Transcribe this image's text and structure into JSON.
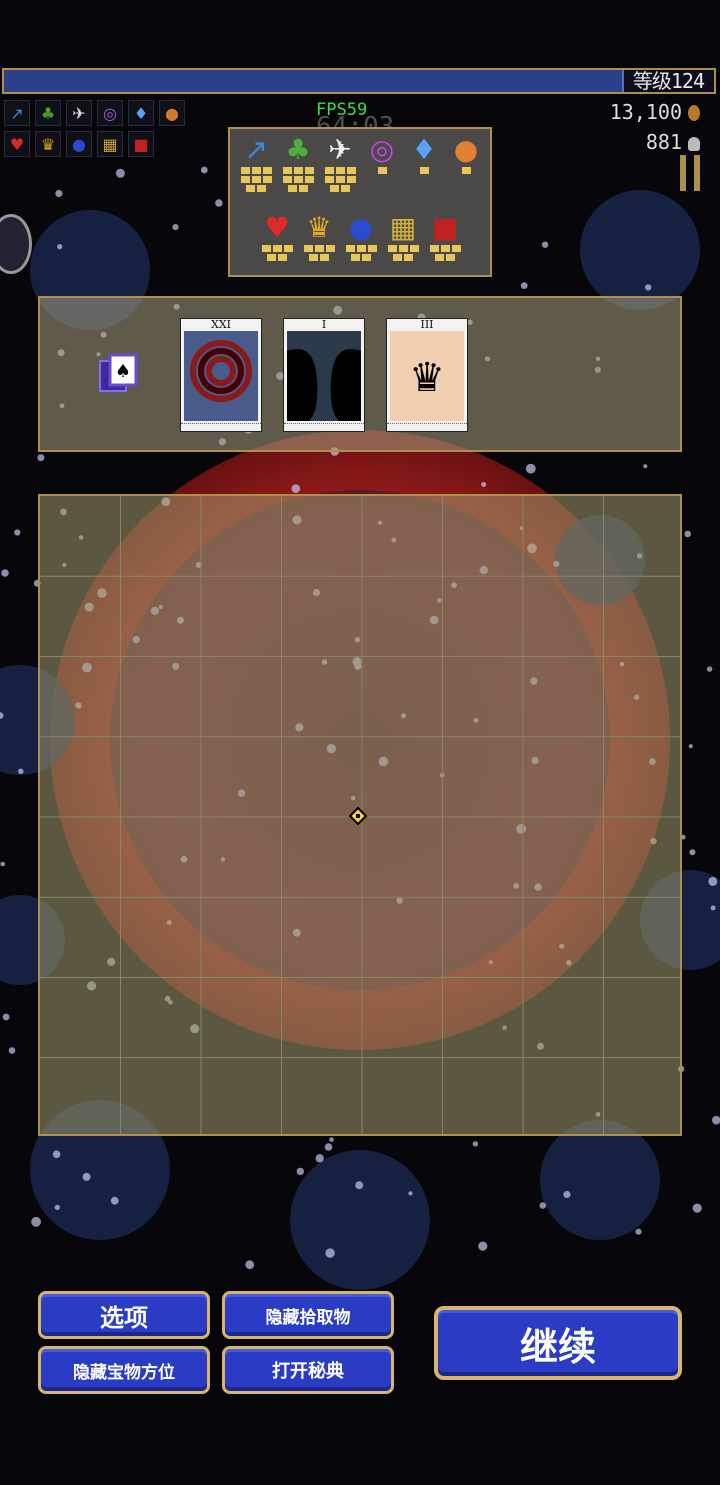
{
  "hud": {
    "level_label": "等级124",
    "xp_fraction": 0.87,
    "fps": "FPS59",
    "timer": "64:03",
    "gold": "13,100",
    "kills": "881"
  },
  "top_left_icons": [
    {
      "name": "whip-icon",
      "glyph": "↗",
      "color": "#3a8be0"
    },
    {
      "name": "palm-icon",
      "glyph": "♣",
      "color": "#4a9a3a"
    },
    {
      "name": "dove-icon",
      "glyph": "✈",
      "color": "#dddddd"
    },
    {
      "name": "spiral-icon",
      "glyph": "◎",
      "color": "#b25ae0"
    },
    {
      "name": "potion-icon",
      "glyph": "♦",
      "color": "#5aa0ff"
    },
    {
      "name": "orb-icon",
      "glyph": "●",
      "color": "#d07a2a"
    },
    {
      "name": "heart-icon",
      "glyph": "♥",
      "color": "#d02a2a"
    },
    {
      "name": "crown-icon",
      "glyph": "♛",
      "color": "#e0a020"
    },
    {
      "name": "blue-orb-icon",
      "glyph": "●",
      "color": "#2a4ad0"
    },
    {
      "name": "lattice-icon",
      "glyph": "▦",
      "color": "#c8a040"
    },
    {
      "name": "tome-icon",
      "glyph": "■",
      "color": "#c02020"
    }
  ],
  "inventory": {
    "weapons": [
      {
        "name": "whip-icon",
        "glyph": "↗",
        "color": "#3a8be0",
        "level": 8
      },
      {
        "name": "palm-icon",
        "glyph": "♣",
        "color": "#4ab03a",
        "level": 8
      },
      {
        "name": "dove-icon",
        "glyph": "✈",
        "color": "#eeeeee",
        "level": 8
      },
      {
        "name": "spiral-icon",
        "glyph": "◎",
        "color": "#c04ae0",
        "level": 1
      },
      {
        "name": "potion-icon",
        "glyph": "♦",
        "color": "#5aa0ff",
        "level": 1
      },
      {
        "name": "orb-icon",
        "glyph": "●",
        "color": "#e08030",
        "level": 1
      }
    ],
    "passives": [
      {
        "name": "heart-icon",
        "glyph": "♥",
        "color": "#e02a2a",
        "level": 5
      },
      {
        "name": "crown-icon",
        "glyph": "♛",
        "color": "#e8a820",
        "level": 5
      },
      {
        "name": "blue-orb-icon",
        "glyph": "●",
        "color": "#2a4ad0",
        "level": 5
      },
      {
        "name": "lattice-icon",
        "glyph": "▦",
        "color": "#d8b040",
        "level": 5
      },
      {
        "name": "tome-icon",
        "glyph": "■",
        "color": "#c02020",
        "level": 5
      }
    ]
  },
  "arcana": {
    "cards": [
      {
        "numeral": "XXI",
        "name": "arcana-card-xxi",
        "bg": "#4a5a8a",
        "motif": "#8a1a1a"
      },
      {
        "numeral": "I",
        "name": "arcana-card-i",
        "bg": "#2a3a4a",
        "motif": "#000000"
      },
      {
        "numeral": "III",
        "name": "arcana-card-iii",
        "bg": "#f0d0b0",
        "motif": "#000000"
      }
    ]
  },
  "buttons": {
    "options": "选项",
    "hide_pickups": "隐藏拾取物",
    "hide_treasure": "隐藏宝物方位",
    "open_codex": "打开秘典",
    "continue": "继续"
  }
}
